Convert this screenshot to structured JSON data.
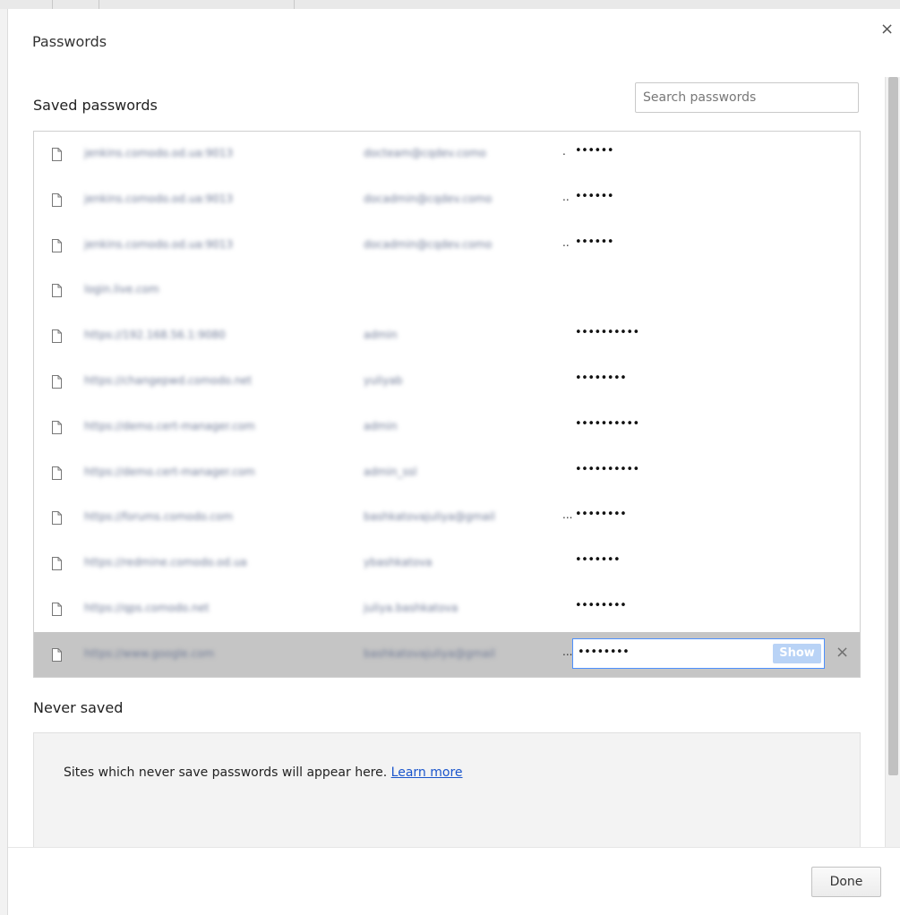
{
  "dialog": {
    "title": "Passwords",
    "close_symbol": "×",
    "done_label": "Done"
  },
  "saved": {
    "heading": "Saved passwords",
    "search_placeholder": "Search passwords",
    "rows": [
      {
        "site": "jenkins.comodo.od.ua:9013",
        "username": "docteam@cqdev.como",
        "username_trunc": ".",
        "password": "••••••",
        "selected": false
      },
      {
        "site": "jenkins.comodo.od.ua:9013",
        "username": "docadmin@cqdev.como",
        "username_trunc": "..",
        "password": "••••••",
        "selected": false
      },
      {
        "site": "jenkins.comodo.od.ua:9013",
        "username": "docadmin@cqdev.como",
        "username_trunc": "..",
        "password": "••••••",
        "selected": false
      },
      {
        "site": "login.live.com",
        "username": "",
        "username_trunc": "",
        "password": "",
        "selected": false
      },
      {
        "site": "https://192.168.56.1:9080",
        "username": "admin",
        "username_trunc": "",
        "password": "••••••••••",
        "selected": false
      },
      {
        "site": "https://changepwd.comodo.net",
        "username": "yuliyab",
        "username_trunc": "",
        "password": "••••••••",
        "selected": false
      },
      {
        "site": "https://demo.cert-manager.com",
        "username": "admin",
        "username_trunc": "",
        "password": "••••••••••",
        "selected": false
      },
      {
        "site": "https://demo.cert-manager.com",
        "username": "admin_ssl",
        "username_trunc": "",
        "password": "••••••••••",
        "selected": false
      },
      {
        "site": "https://forums.comodo.com",
        "username": "bashkatovajuliya@gmail",
        "username_trunc": "...",
        "password": "••••••••",
        "selected": false
      },
      {
        "site": "https://redmine.comodo.od.ua",
        "username": "ybashkatova",
        "username_trunc": "",
        "password": "•••••••",
        "selected": false
      },
      {
        "site": "https://qps.comodo.net",
        "username": "juliya.bashkatova",
        "username_trunc": "",
        "password": "••••••••",
        "selected": false
      },
      {
        "site": "https://www.google.com",
        "username": "bashkatovajuliya@gmail",
        "username_trunc": "...",
        "password": "••••••••",
        "selected": true,
        "show_label": "Show",
        "delete_symbol": "×"
      }
    ]
  },
  "never_saved": {
    "heading": "Never saved",
    "message": "Sites which never save passwords will appear here.",
    "learn_more": "Learn more"
  },
  "icons": {
    "row_icon": "document-icon",
    "close": "close-icon",
    "delete": "delete-icon"
  },
  "colors": {
    "selected_row": "#c5c5c5",
    "focus_border": "#4d90fe",
    "show_button": "#b9d3f6",
    "link": "#1a55cc"
  }
}
